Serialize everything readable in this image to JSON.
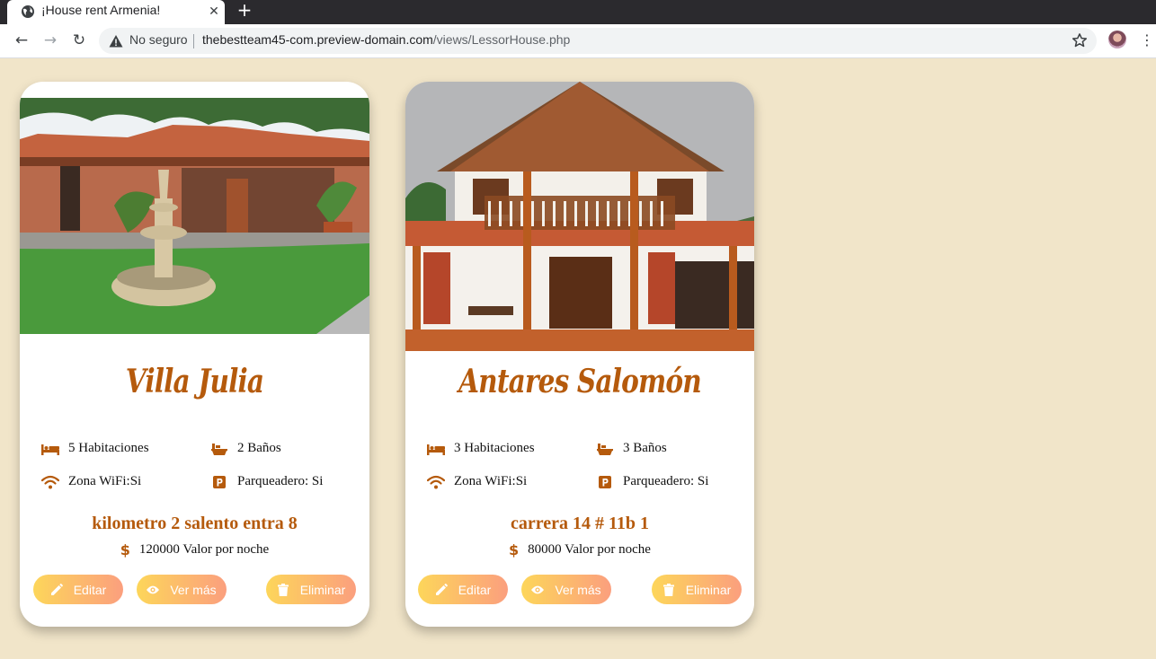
{
  "browser": {
    "tab_title": "¡House rent Armenia!",
    "new_tab": "+",
    "security_label": "No seguro",
    "url_host": "thebestteam45-com.preview-domain.com",
    "url_path": "/views/LessorHouse.php"
  },
  "houses": [
    {
      "name": "Villa Julia",
      "rooms": "5 Habitaciones",
      "baths": "2 Baños",
      "wifi": "Zona WiFi:Si",
      "parking": "Parqueadero: Si",
      "address": "kilometro 2 salento entra 8",
      "price": "120000 Valor por noche"
    },
    {
      "name": "Antares Salomón",
      "rooms": "3 Habitaciones",
      "baths": "3 Baños",
      "wifi": "Zona WiFi:Si",
      "parking": "Parqueadero: Si",
      "address": "carrera 14 # 11b 1",
      "price": "80000 Valor por noche"
    }
  ],
  "buttons": {
    "edit": "Editar",
    "view": "Ver más",
    "delete": "Eliminar"
  },
  "icons": {
    "bed": "bed-icon",
    "bath": "bath-icon",
    "wifi": "wifi-icon",
    "parking": "parking-icon",
    "price": "dollar-icon",
    "edit": "pencil-icon",
    "view": "eye-icon",
    "delete": "trash-icon"
  },
  "colors": {
    "accent": "#b55a0c",
    "page_background": "#f1e5c9",
    "button_gradient_start": "#fdd65a",
    "button_gradient_end": "#fb9f7e"
  }
}
